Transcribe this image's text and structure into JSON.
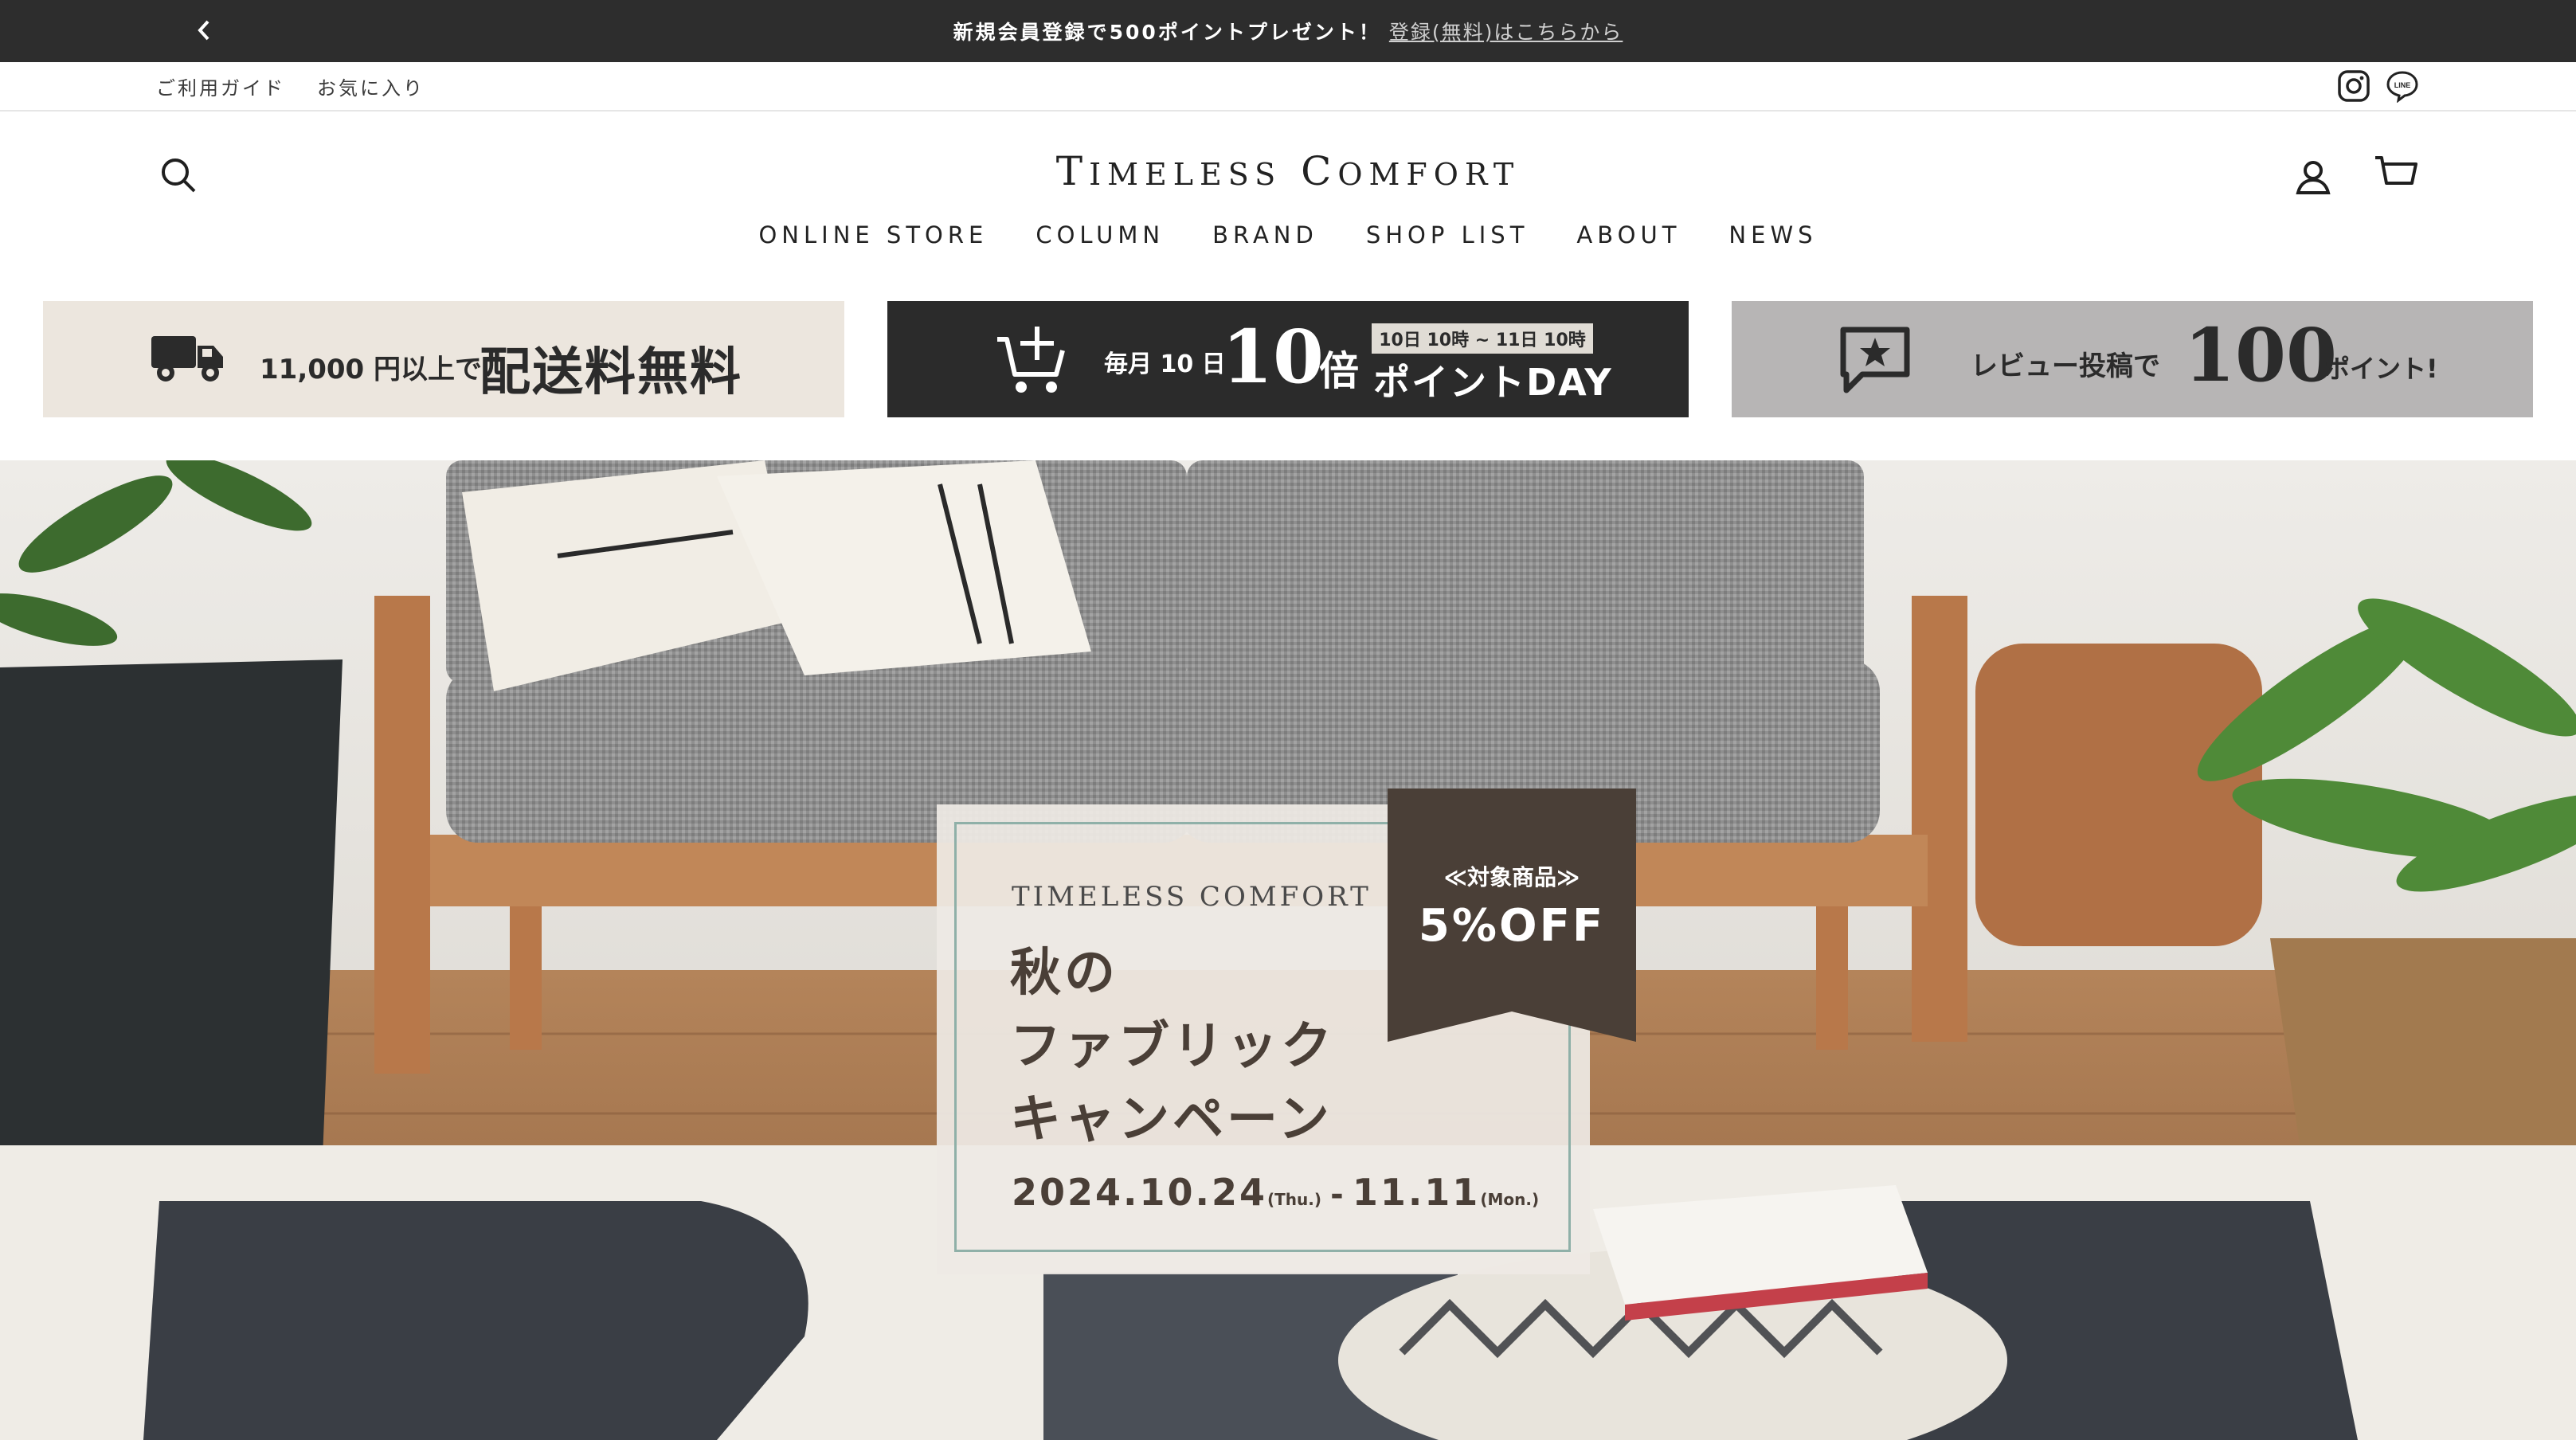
{
  "announcement": {
    "message": "新規会員登録で500ポイントプレゼント！",
    "link_text": "登録(無料)はこちらから"
  },
  "utility": {
    "guide": "ご利用ガイド",
    "favorites": "お気に入り"
  },
  "brand": {
    "logo_first": "T",
    "logo_rest": "IMELESS",
    "logo_second_first": "C",
    "logo_second_rest": "OMFORT"
  },
  "nav": {
    "items": [
      "ONLINE STORE",
      "COLUMN",
      "BRAND",
      "SHOP LIST",
      "ABOUT",
      "NEWS"
    ]
  },
  "promos": {
    "shipping": {
      "prefix": "11,000 円以上で",
      "main": "配送料無料"
    },
    "points_day": {
      "prefix": "毎月 10 日",
      "big": "10",
      "mult": "倍",
      "time": "10日 10時 ~ 11日 10時",
      "main": "ポイントDAY"
    },
    "review": {
      "prefix": "レビュー投稿で",
      "big": "100",
      "suffix": "ポイント!"
    }
  },
  "campaign": {
    "brand": "TIMELESS COMFORT",
    "title_line1": "秋の",
    "title_line2": "ファブリック",
    "title_line3": "キャンペーン",
    "date_start": "2024.10.24",
    "date_start_day": "(Thu.)",
    "date_sep": "-",
    "date_end": "11.11",
    "date_end_day": "(Mon.)",
    "ribbon_top": "≪対象商品≫",
    "ribbon_main": "5%OFF"
  },
  "colors": {
    "announcement_bg": "#2d2d2d",
    "promo_beige": "#ece6de",
    "promo_dark": "#2b2b2b",
    "promo_grey": "#b7b5b5",
    "ribbon": "#4a3f37",
    "card_frame": "#8fb0a8"
  },
  "icons": {
    "announcement_prev": "chevron-left-icon",
    "instagram": "instagram-icon",
    "line": "line-icon",
    "search": "search-icon",
    "account": "account-icon",
    "cart": "cart-icon",
    "truck": "truck-icon",
    "cart_plus": "cart-plus-icon",
    "review": "review-star-icon"
  }
}
